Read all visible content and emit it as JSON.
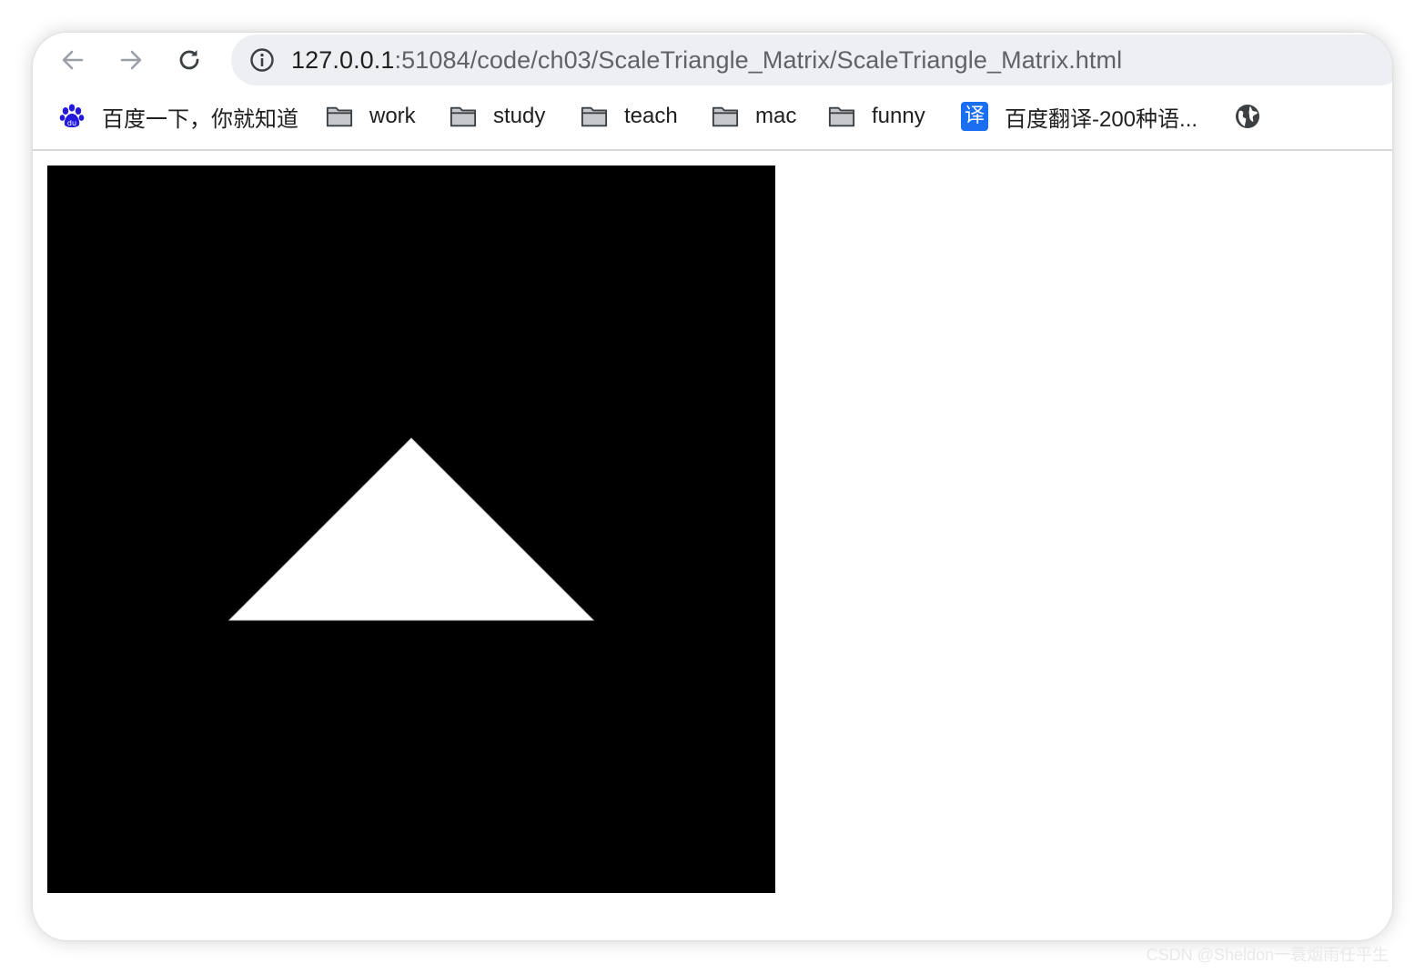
{
  "browser": {
    "url_host": "127.0.0.1",
    "url_path": ":51084/code/ch03/ScaleTriangle_Matrix/ScaleTriangle_Matrix.html"
  },
  "bookmarks": [
    {
      "label": "百度一下，你就知道",
      "icon": "baidu-paw-icon"
    },
    {
      "label": "work",
      "icon": "folder-icon"
    },
    {
      "label": "study",
      "icon": "folder-icon"
    },
    {
      "label": "teach",
      "icon": "folder-icon"
    },
    {
      "label": "mac",
      "icon": "folder-icon"
    },
    {
      "label": "funny",
      "icon": "folder-icon"
    },
    {
      "label": "百度翻译-200种语...",
      "icon": "translate-icon",
      "badge": "译"
    },
    {
      "label": "",
      "icon": "globe-icon"
    }
  ],
  "canvas": {
    "background": "#000000",
    "triangle_color": "#ffffff"
  },
  "watermark": "CSDN @Sheldon一蓑烟雨任平生",
  "colors": {
    "baidu_blue": "#2319dc",
    "fanyi_blue": "#1a6ef2",
    "omnibox_bg": "#edeff2"
  }
}
